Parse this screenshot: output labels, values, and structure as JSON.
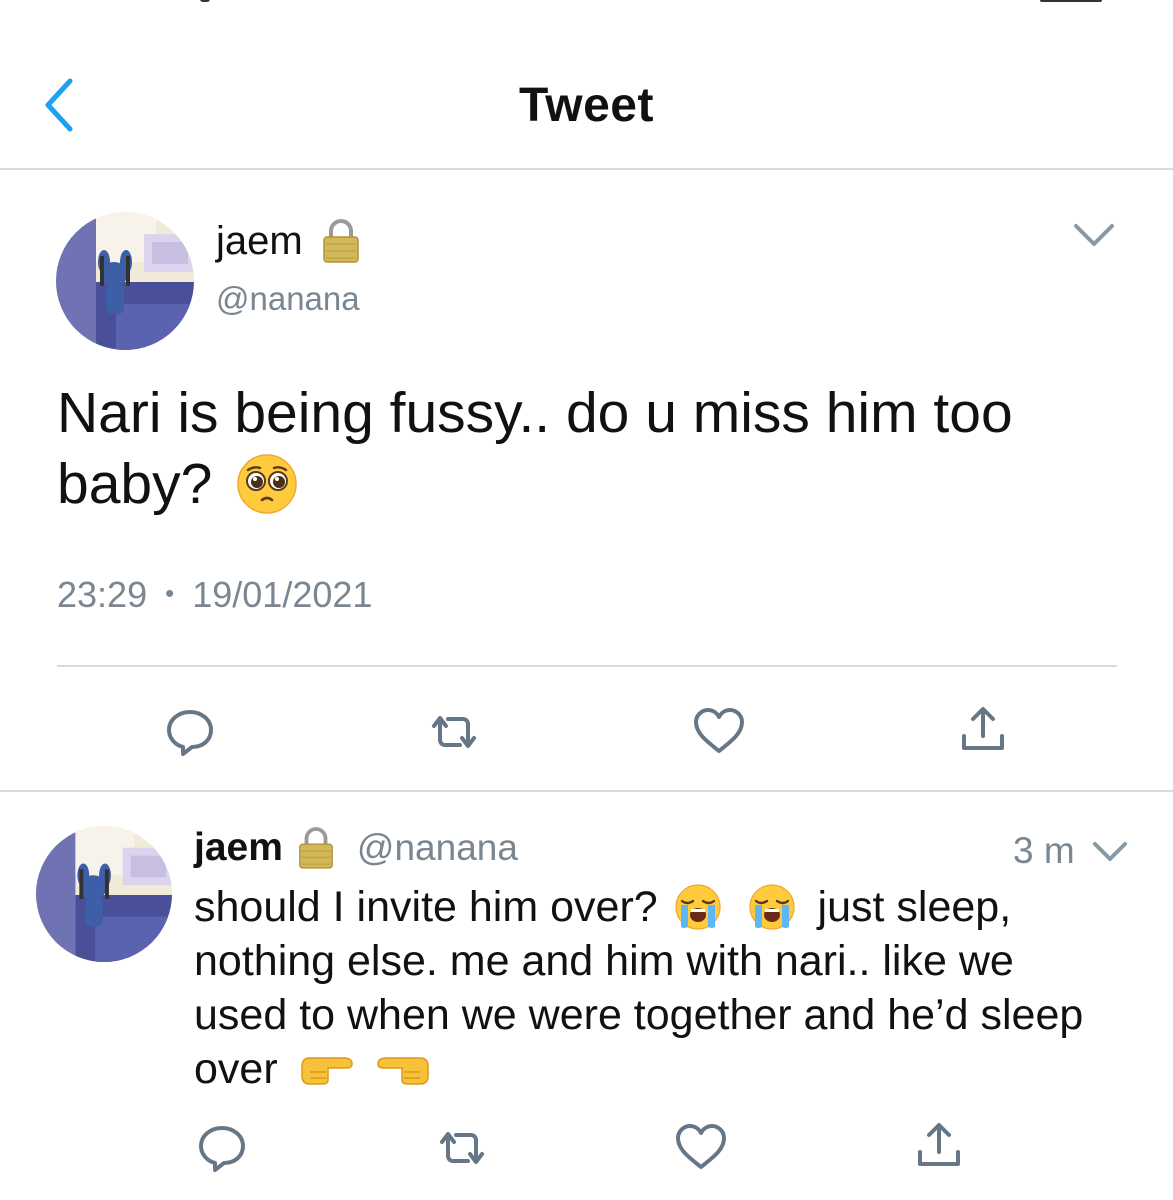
{
  "header": {
    "title": "Tweet"
  },
  "main_tweet": {
    "name": "jaem",
    "handle": "@nanana",
    "text": "Nari is being fussy.. do u miss him too baby?",
    "time": "23:29",
    "separator": "•",
    "date": "19/01/2021"
  },
  "reply_tweet": {
    "name": "jaem",
    "handle": "@nanana",
    "time_ago": "3 m",
    "text_part1": "should I invite him over?",
    "text_part2": "just sleep, nothing else. me and him with nari.. like we used to when we were together and he’d sleep over"
  },
  "icons": {
    "back": "chevron-left-icon",
    "lock": "lock-icon",
    "caret": "chevron-down-icon",
    "reply": "reply-icon",
    "retweet": "retweet-icon",
    "like": "heart-icon",
    "share": "share-icon",
    "emoji_pleading": "pleading-face-emoji",
    "emoji_crying": "loudly-crying-face-emoji",
    "emoji_point_right": "backhand-index-pointing-right-emoji",
    "emoji_point_left": "backhand-index-pointing-left-emoji"
  },
  "colors": {
    "accent": "#1DA1F2",
    "icon_gray": "#657786",
    "secondary_text": "#7a8691",
    "divider": "#d8dbdd"
  }
}
